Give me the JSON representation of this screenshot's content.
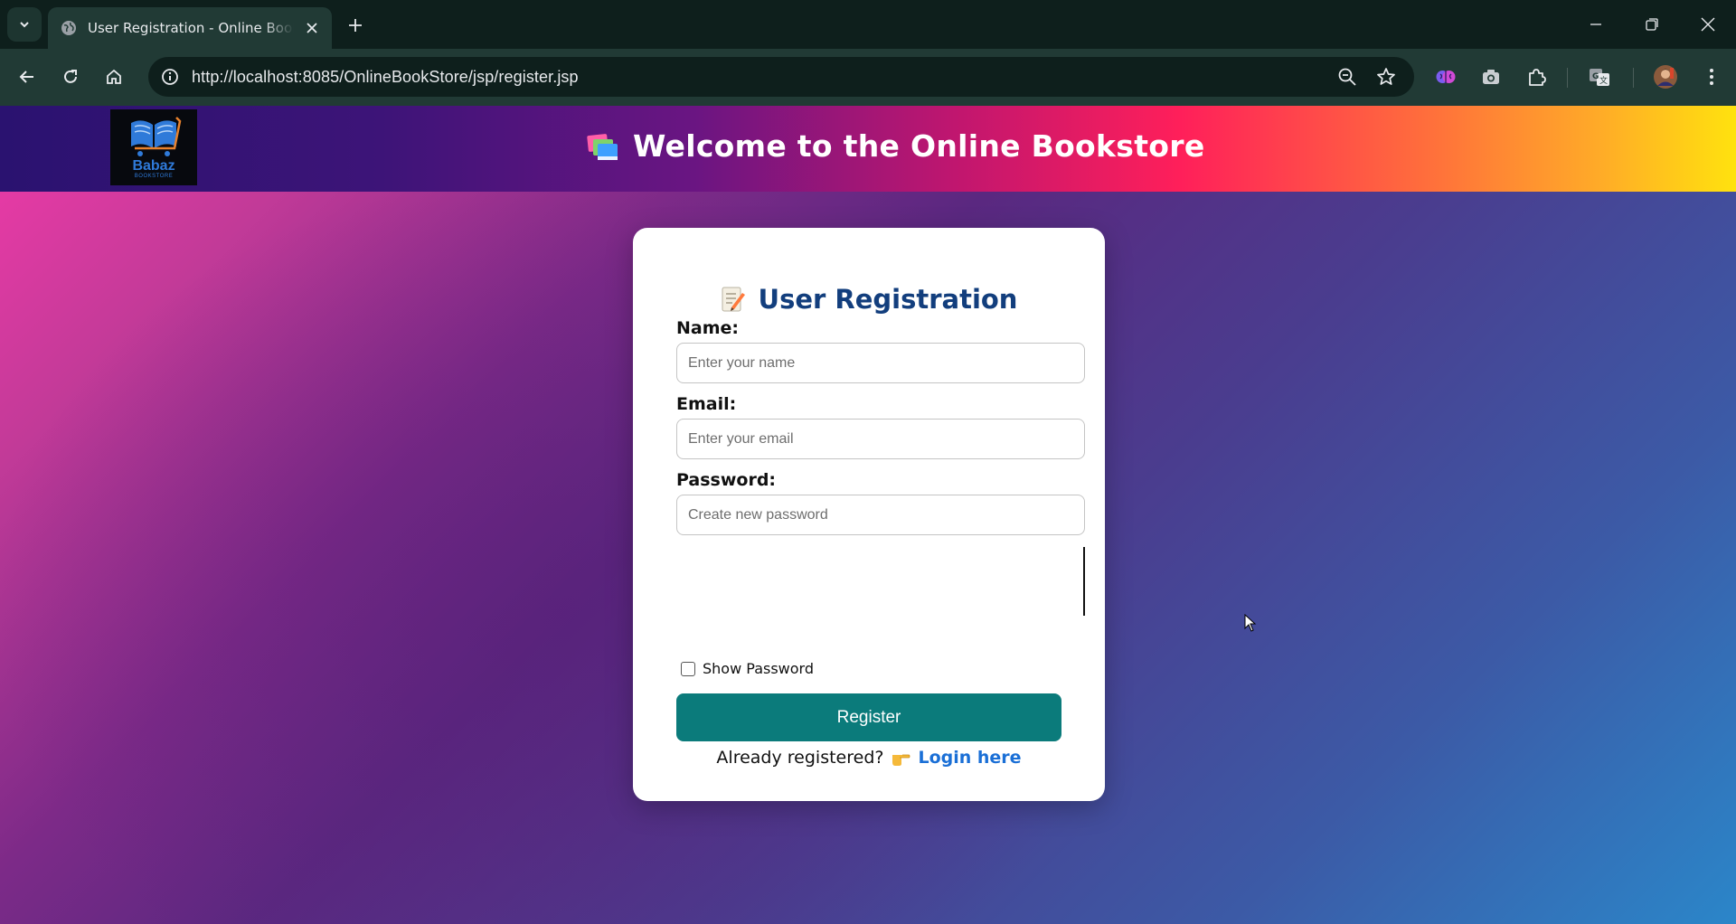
{
  "browser": {
    "tab_title": "User Registration - Online Book Store",
    "url": "http://localhost:8085/OnlineBookStore/jsp/register.jsp"
  },
  "header": {
    "logo_text": "Babaz",
    "logo_subtext": "BOOKSTORE",
    "title": "Welcome to the Online Bookstore",
    "title_icon": "books-icon"
  },
  "form": {
    "title": "User Registration",
    "title_icon": "memo-icon",
    "name_label": "Name:",
    "name_placeholder": "Enter your name",
    "name_value": "",
    "email_label": "Email:",
    "email_placeholder": "Enter your email",
    "email_value": "",
    "password_label": "Password:",
    "password_placeholder": "Create new password",
    "password_value": "",
    "show_password_label": "Show Password",
    "show_password_checked": false,
    "register_label": "Register",
    "already_text": "Already registered?",
    "login_link": "Login here"
  },
  "colors": {
    "primary_button": "#0b7b7b",
    "heading": "#123e7d",
    "link": "#1a6fd6"
  }
}
